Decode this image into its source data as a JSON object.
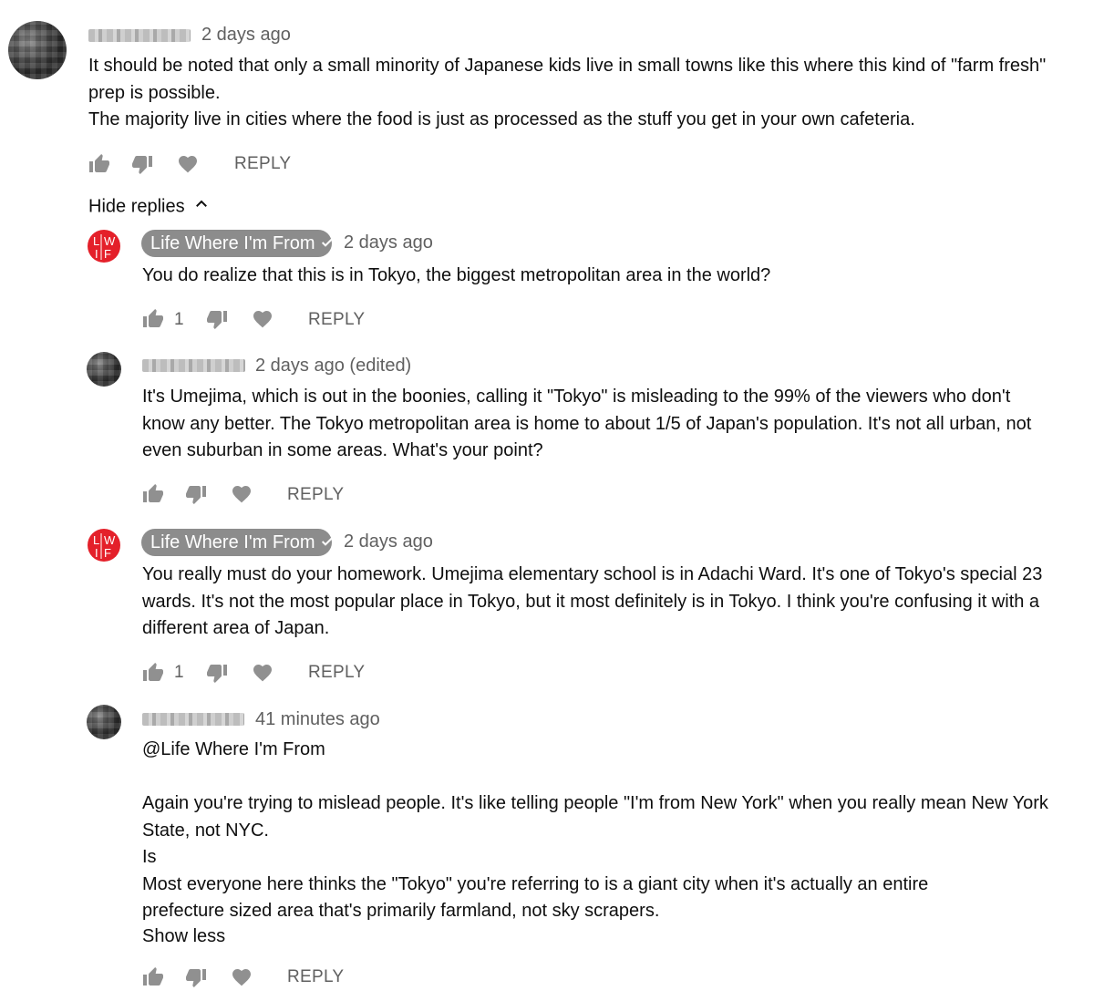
{
  "comments": [
    {
      "time": "2 days ago",
      "paragraphs": [
        "It should be noted that only a small minority of Japanese kids live in small towns like this where this kind of \"farm fresh\" prep is possible.",
        "The majority live in cities where the food is just as processed as the stuff you get in your own cafeteria."
      ],
      "reply_label": "REPLY",
      "hide_replies_label": "Hide replies"
    }
  ],
  "replies": [
    {
      "author": "Life Where I'm From",
      "time": "2 days ago",
      "paragraphs": [
        "You do realize that this is in Tokyo, the biggest metropolitan area in the world?"
      ],
      "likes": "1",
      "reply_label": "REPLY"
    },
    {
      "time": "2 days ago (edited)",
      "paragraphs": [
        "It's Umejima, which is out in the boonies, calling it \"Tokyo\" is misleading to the 99% of the viewers who don't know any better. The Tokyo metropolitan area is home to about 1/5 of Japan's population. It's not all urban, not even suburban in some areas. What's your point?"
      ],
      "reply_label": "REPLY"
    },
    {
      "author": "Life Where I'm From",
      "time": "2 days ago",
      "paragraphs": [
        "You really must do your homework. Umejima elementary school is in Adachi Ward. It's one of Tokyo's special 23 wards. It's not the most popular place in Tokyo, but it most definitely is in Tokyo. I think you're confusing it with a different area of Japan."
      ],
      "likes": "1",
      "reply_label": "REPLY"
    },
    {
      "time": "41 minutes ago",
      "paragraphs": [
        "@Life Where I'm From",
        "",
        "Again you're trying to mislead people. It's like telling people \"I'm from New York\" when you really mean New York State, not NYC.",
        "Is",
        "Most everyone here thinks the \"Tokyo\" you're referring to is a giant city when it's actually an entire prefecture sized area that's primarily farmland, not sky scrapers."
      ],
      "show_less_label": "Show less",
      "reply_label": "REPLY"
    }
  ],
  "icons": {
    "like": "thumbs-up-icon",
    "dislike": "thumbs-down-icon",
    "heart": "heart-icon",
    "verified": "verified-check-icon",
    "chevron": "chevron-up-icon",
    "logo": "lwif-logo-icon"
  },
  "colors": {
    "meta_gray": "#606060",
    "chip_gray": "#8c8c8c",
    "logo_red": "#e4202a",
    "icon_gray": "#909090"
  }
}
